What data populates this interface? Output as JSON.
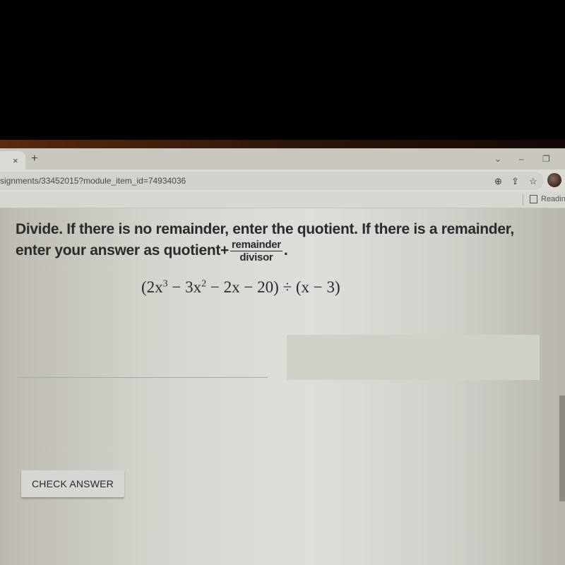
{
  "browser": {
    "tab_close_glyph": "×",
    "new_tab_glyph": "+",
    "window_controls": {
      "tab_search": "⌄",
      "minimize": "–",
      "restore": "❐"
    },
    "url": "signments/33452015?module_item_id=74934036",
    "toolbar_icons": [
      "zoom-icon",
      "share-icon",
      "star-icon",
      "profile-avatar"
    ],
    "toolbar_glyphs": {
      "zoom": "⊕",
      "share": "⇪",
      "star": "☆"
    },
    "bookmarks_bar": {
      "reading_list_label": "Reading"
    }
  },
  "question": {
    "line1": "Divide. If there is no remainder, enter the quotient. If there is a remainder,",
    "line2_prefix": "enter your answer as quotient+",
    "fraction_numerator": "remainder",
    "fraction_denominator": "divisor",
    "line2_suffix": ".",
    "expression": {
      "open": "(2x",
      "exp1": "3",
      "part2": " − 3x",
      "exp2": "2",
      "part3": " − 2x − 20) ÷ (x − 3)"
    }
  },
  "answer": {
    "input_value": "",
    "placeholder": ""
  },
  "actions": {
    "check_answer_label": "CHECK ANSWER"
  }
}
